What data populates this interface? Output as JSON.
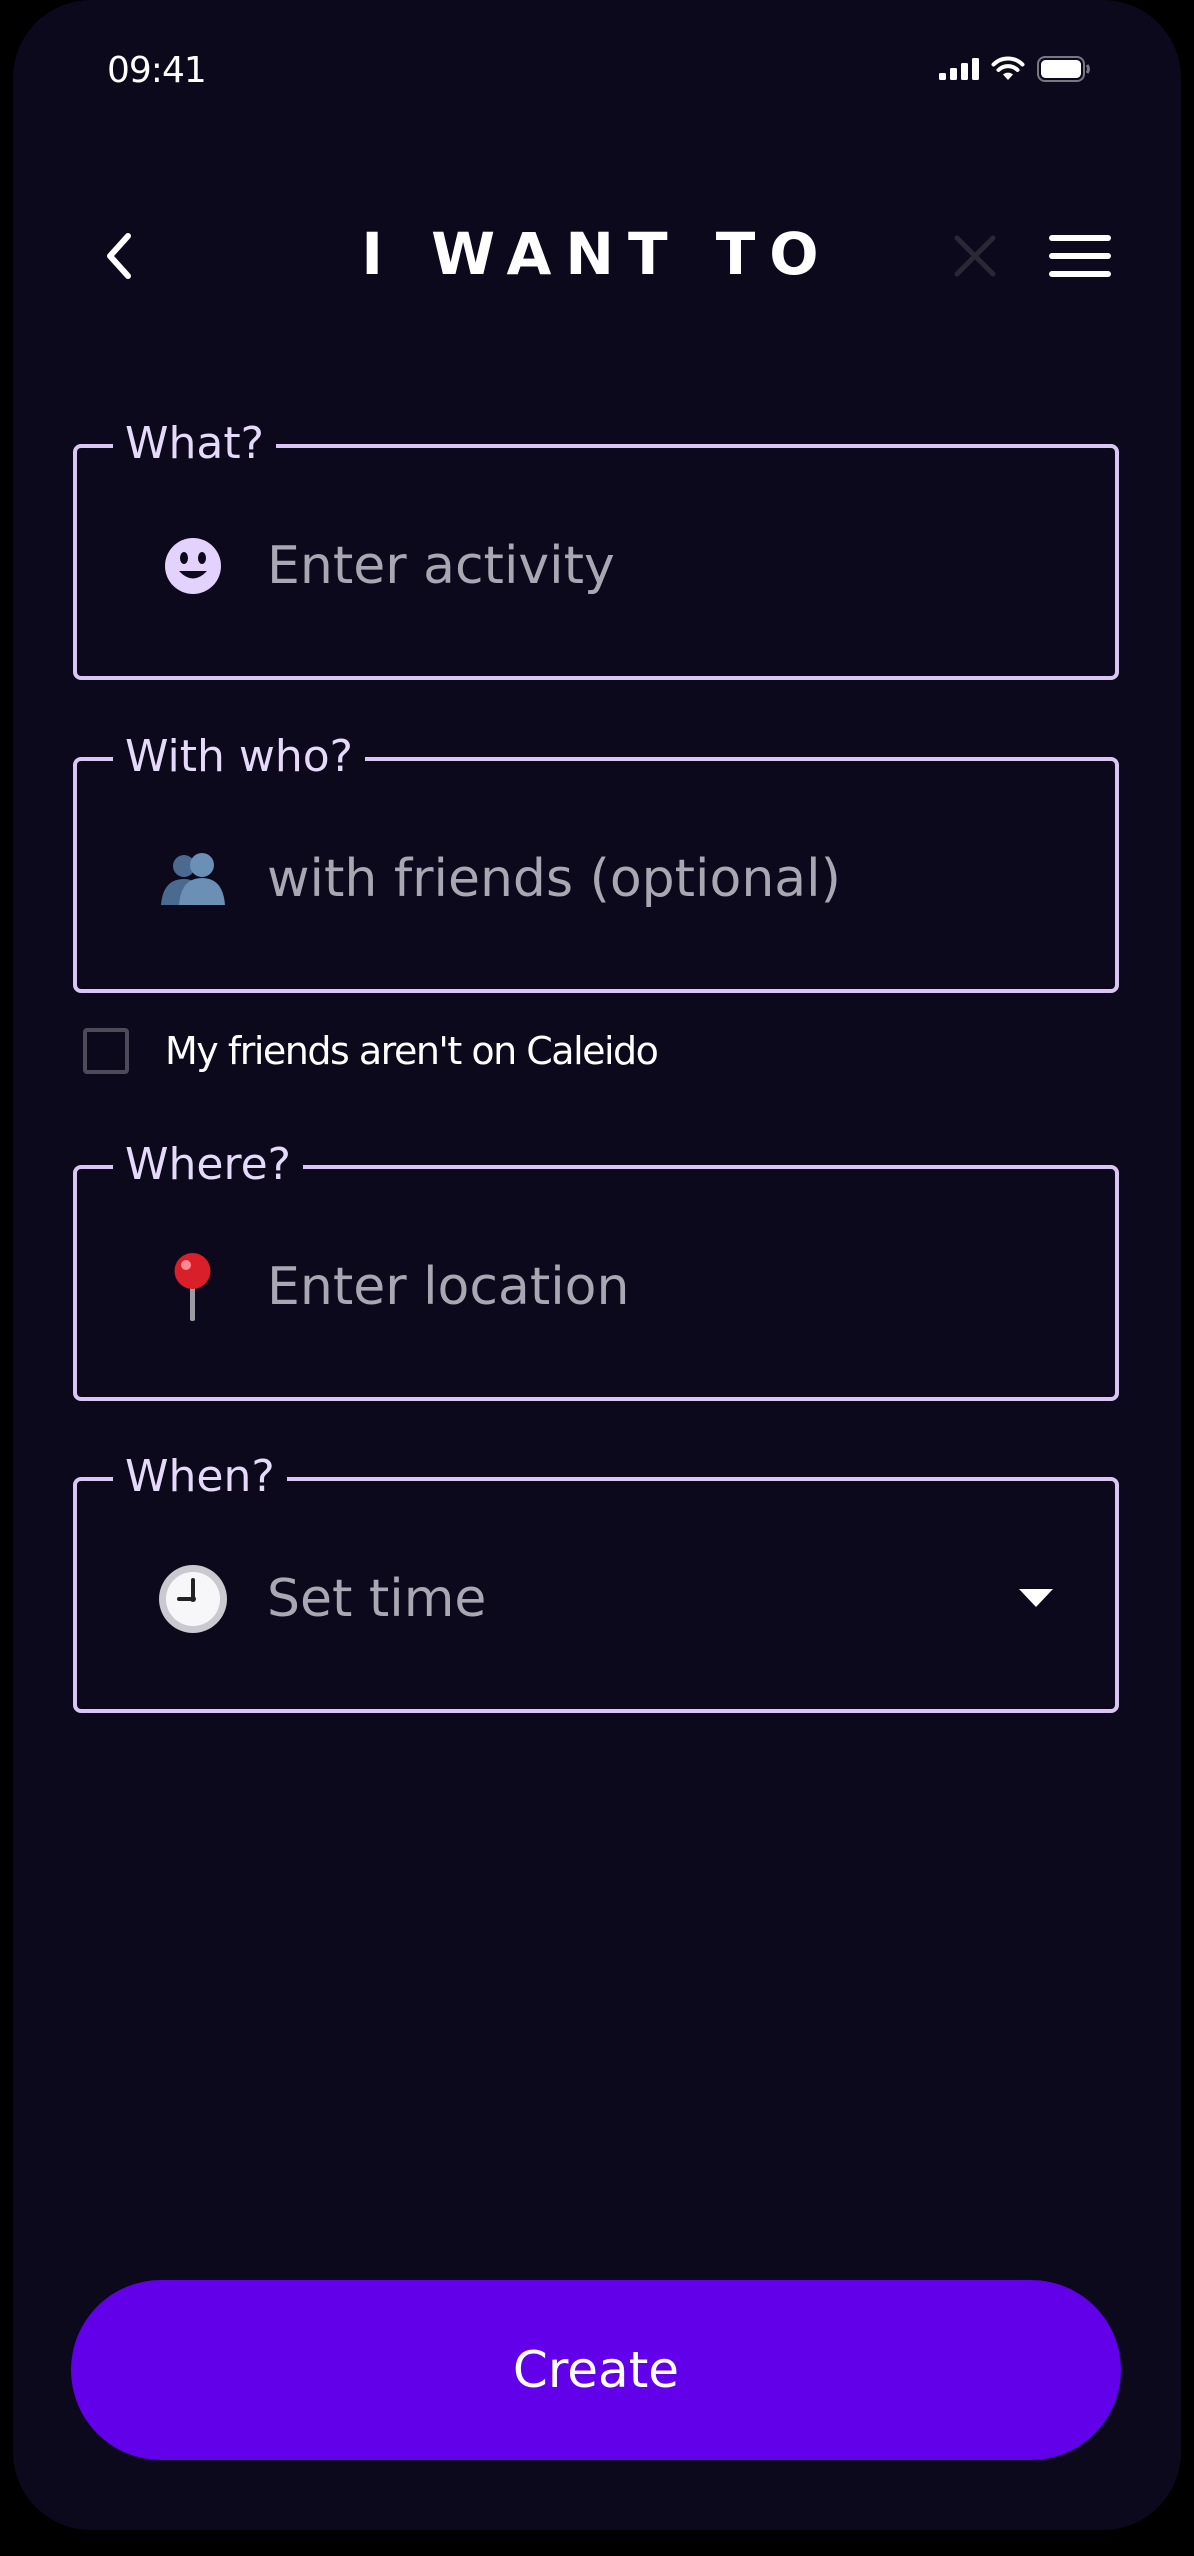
{
  "status_bar": {
    "time": "09:41"
  },
  "header": {
    "title": "I WANT TO",
    "back_icon": "chevron-left-icon",
    "close_icon": "close-icon",
    "menu_icon": "hamburger-menu-icon"
  },
  "form": {
    "what": {
      "legend": "What?",
      "placeholder": "Enter activity",
      "icon": "smiley-face-icon"
    },
    "with_who": {
      "legend": "With who?",
      "placeholder": "with friends (optional)",
      "icon": "people-silhouette-icon"
    },
    "friends_checkbox": {
      "label": "My friends aren't on Caleido",
      "checked": false
    },
    "where": {
      "legend": "Where?",
      "placeholder": "Enter location",
      "icon": "round-pushpin-icon"
    },
    "when": {
      "legend": "When?",
      "placeholder": "Set time",
      "icon": "clock-icon"
    }
  },
  "actions": {
    "create_label": "Create"
  },
  "colors": {
    "background": "#0b091b",
    "field_border": "#d9c6f5",
    "accent": "#6200ea",
    "placeholder": "#a9a7b2"
  }
}
